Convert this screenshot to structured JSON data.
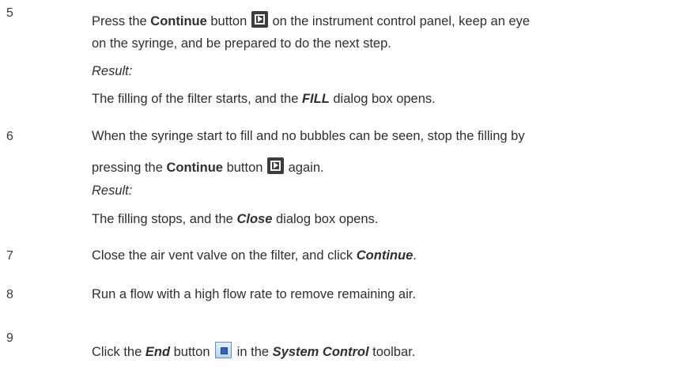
{
  "steps": [
    {
      "number": "5",
      "lines": [
        {
          "a": "Press the ",
          "b_continue": "Continue",
          "c": " button",
          "d": " on the instrument control panel, keep an eye"
        },
        "on the syringe, and be prepared to do the next step."
      ],
      "result_label": "Result:",
      "result": {
        "a": "The filling of the filter starts, and the ",
        "b": "FILL",
        "c": " dialog box opens."
      }
    },
    {
      "number": "6",
      "lines": [
        "When the syringe start to fill and no bubbles can be seen, stop the filling by",
        {
          "a": "pressing the ",
          "b_continue": "Continue",
          "c": " button",
          "d": " again."
        }
      ],
      "result_label": "Result:",
      "result": {
        "a": "The filling stops, and the ",
        "b": "Close",
        "c": " dialog box opens."
      }
    },
    {
      "number": "7",
      "text": {
        "a": "Close the air vent valve on the filter, and click ",
        "b": "Continue",
        "c": "."
      }
    },
    {
      "number": "8",
      "text": "Run a flow with a high flow rate to remove remaining air."
    },
    {
      "number": "9",
      "text": {
        "a": "Click the ",
        "b": "End",
        "c": " button",
        "d": " in the ",
        "e": "System Control",
        "f": " toolbar."
      }
    }
  ],
  "icons": {
    "continue": "continue-button-icon",
    "end": "end-button-icon"
  }
}
